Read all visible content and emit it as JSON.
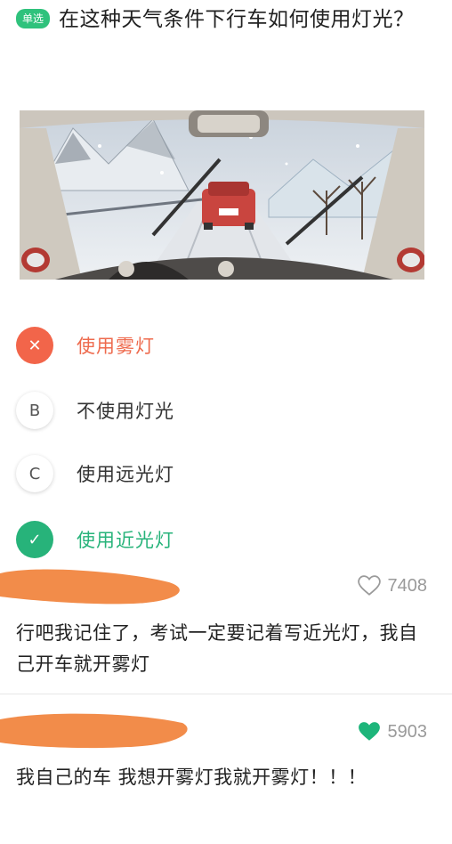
{
  "question": {
    "tag": "单选",
    "text": "在这种天气条件下行车如何使用灯光？"
  },
  "options": [
    {
      "marker": "✕",
      "label": "使用雾灯",
      "state": "wrong"
    },
    {
      "marker": "B",
      "label": "不使用灯光",
      "state": "normal"
    },
    {
      "marker": "C",
      "label": "使用远光灯",
      "state": "normal"
    },
    {
      "marker": "✓",
      "label": "使用近光灯",
      "state": "right"
    }
  ],
  "comments": [
    {
      "likes": "7408",
      "liked": false,
      "text": "行吧我记住了，考试一定要记着写近光灯，我自己开车就开雾灯"
    },
    {
      "likes": "5903",
      "liked": true,
      "text": "我自己的车 我想开雾灯我就开雾灯！！！"
    }
  ],
  "colors": {
    "accent_green": "#27b37a",
    "wrong_red": "#f2654a",
    "redaction_orange": "#f28c4a",
    "like_green": "#1db57a"
  }
}
